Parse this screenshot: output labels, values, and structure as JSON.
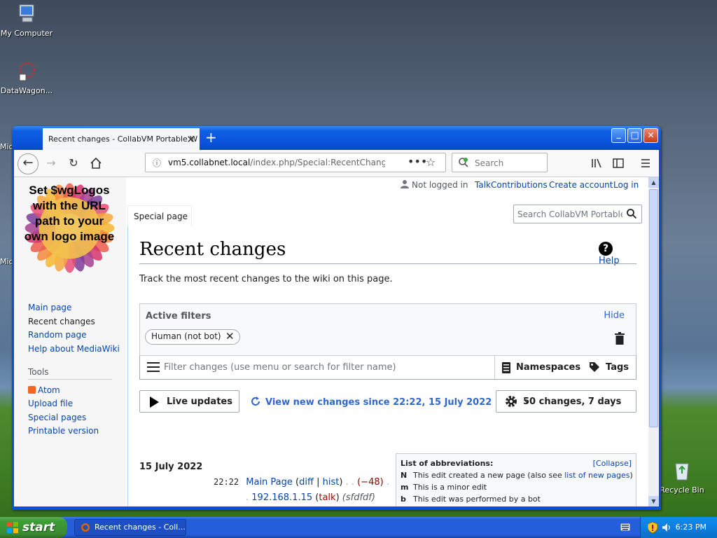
{
  "desktop": {
    "icons": [
      {
        "label": "My Computer"
      },
      {
        "label": "DataWagon..."
      },
      {
        "label": "Recycle Bin"
      }
    ],
    "partial_labels": [
      "Mic",
      "Mic"
    ]
  },
  "taskbar": {
    "start_label": "start",
    "task_label": "Recent changes - Coll...",
    "clock": "6:23 PM"
  },
  "browser": {
    "tab_title": "Recent changes - CollabVM Portable W",
    "new_tab": "+",
    "url_domain": "vm5.collabnet.local",
    "url_path": "/index.php/Special:RecentChange",
    "page_actions": "•••",
    "search_placeholder": "Search",
    "window_buttons": {
      "minimize": "_",
      "maximize": "□",
      "close": "✕"
    }
  },
  "wiki": {
    "logo_text": "Set $wgLogos with the URL path to your own logo image",
    "personal": {
      "status": "Not logged in",
      "talk": "Talk",
      "contributions": "Contributions",
      "create_account": "Create account",
      "log_in": "Log in"
    },
    "tab_label": "Special page",
    "search_placeholder": "Search CollabVM Portable",
    "nav": [
      "Main page",
      "Recent changes",
      "Random page",
      "Help about MediaWiki"
    ],
    "tools_heading": "Tools",
    "tools": [
      "Atom",
      "Upload file",
      "Special pages",
      "Printable version"
    ],
    "title": "Recent changes",
    "help": "Help",
    "intro": "Track the most recent changes to the wiki on this page.",
    "filters": {
      "heading": "Active filters",
      "hide": "Hide",
      "chip": "Human (not bot)",
      "placeholder": "Filter changes (use menu or search for filter name)",
      "namespaces": "Namespaces",
      "tags": "Tags"
    },
    "live_updates": "Live updates",
    "view_new": "View new changes since 22:22, 15 July 2022",
    "changes_setting": "50 changes, 7 days",
    "legend": {
      "heading": "List of abbreviations:",
      "collapse": "[Collapse]",
      "n_key": "N",
      "n_text": "This edit created a new page (also see ",
      "n_link": "list of new pages",
      "n_end": ")",
      "m_key": "m",
      "m_text": "This is a minor edit",
      "b_key": "b",
      "b_text": "This edit was performed by a bot"
    },
    "day": "15 July 2022",
    "entry": {
      "time": "22:22",
      "page": "Main Page",
      "diff": "diff",
      "hist": "hist",
      "size_change": "(−48)",
      "user": "192.168.1.15",
      "talk": "talk",
      "summary": "(sfdfdf)"
    }
  }
}
